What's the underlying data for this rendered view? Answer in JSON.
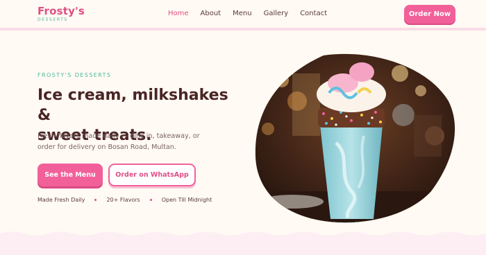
{
  "brand": {
    "name": "Frosty's",
    "tagline": "DESSERTS"
  },
  "nav": {
    "items": [
      {
        "label": "Home",
        "active": true
      },
      {
        "label": "About",
        "active": false
      },
      {
        "label": "Menu",
        "active": false
      },
      {
        "label": "Gallery",
        "active": false
      },
      {
        "label": "Contact",
        "active": false
      }
    ],
    "order_button": "Order Now"
  },
  "hero": {
    "eyebrow": "FROSTY'S DESSERTS",
    "headline_line1": "Ice cream, milkshakes &",
    "headline_line2": "sweet treats.",
    "subtitle": "Fresh flavors made daily — dine in, takeaway, or order for delivery on Bosan Road, Multan.",
    "primary_button": "See the Menu",
    "secondary_button": "Order on WhatsApp",
    "features": [
      "Made Fresh Daily",
      "20+ Flavors",
      "Open Till Midnight"
    ],
    "image_icon": "milkshake-photo"
  },
  "colors": {
    "accent": "#f2609a",
    "accent_dark": "#e04e85",
    "mint": "#4bb89a",
    "background": "#fffaf3",
    "heading": "#4a2525"
  }
}
